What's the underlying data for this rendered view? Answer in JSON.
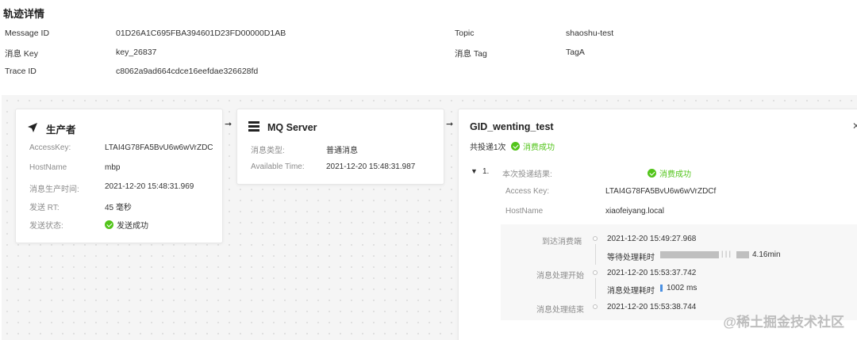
{
  "title": "轨迹详情",
  "info": {
    "message_id_label": "Message ID",
    "message_id_value": "01D26A1C695FBA394601D23FD00000D1AB",
    "key_label": "消息 Key",
    "key_value": "key_26837",
    "trace_label": "Trace ID",
    "trace_value": "c8062a9ad664cdce16eefdae326628fd",
    "topic_label": "Topic",
    "topic_value": "shaoshu-test",
    "tag_label": "消息 Tag",
    "tag_value": "TagA"
  },
  "producer": {
    "title": "生产者",
    "icon": "send-icon",
    "rows": [
      {
        "label": "AccessKey:",
        "value": "LTAI4G78FA5BvU6w6wVrZDC"
      },
      {
        "label": "HostName",
        "value": "mbp"
      },
      {
        "label": "消息生产时间:",
        "value": "2021-12-20 15:48:31.969"
      },
      {
        "label": "发送 RT:",
        "value": "45 毫秒"
      },
      {
        "label": "发送状态:",
        "value": "发送成功"
      }
    ]
  },
  "server": {
    "title": "MQ Server",
    "icon": "server-icon",
    "rows": [
      {
        "label": "消息类型:",
        "value": "普通消息"
      },
      {
        "label": "Available Time:",
        "value": "2021-12-20 15:48:31.987"
      }
    ]
  },
  "consumer": {
    "title": "GID_wenting_test",
    "delivery_summary": "共投递1次",
    "summary_status": "消费成功",
    "index": "1.",
    "result_label": "本次投递结果:",
    "result_status": "消费成功",
    "access_key_label": "Access Key:",
    "access_key_value": "LTAI4G78FA5BvU6w6wVrZDCf",
    "hostname_label": "HostName",
    "hostname_value": "xiaofeiyang.local",
    "timeline": [
      {
        "label": "到达消费端",
        "time": "2021-12-20 15:49:27.968"
      },
      {
        "label": "消息处理开始",
        "time": "2021-12-20 15:53:37.742"
      },
      {
        "label": "消息处理结束",
        "time": "2021-12-20 15:53:38.744"
      }
    ],
    "wait_label": "等待处理耗时",
    "wait_value": "4.16min",
    "proc_label": "消息处理耗时",
    "proc_value": "1002 ms"
  },
  "watermark": "@稀土掘金技术社区",
  "colors": {
    "success": "#52c41a",
    "canvas": "#f5f5f5",
    "proc_bar": "#4a90e2"
  }
}
